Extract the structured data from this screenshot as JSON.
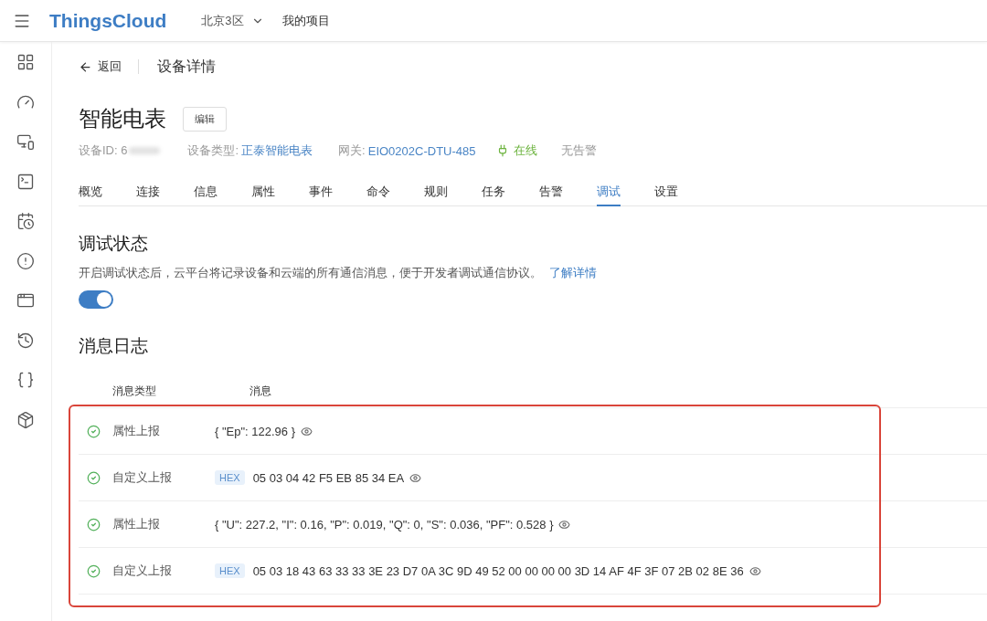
{
  "topbar": {
    "brand": "ThingsCloud",
    "region": "北京3区",
    "project": "我的项目"
  },
  "sidebar": {
    "items": [
      {
        "kind": "grid"
      },
      {
        "kind": "gauge"
      },
      {
        "kind": "devices"
      },
      {
        "kind": "terminal"
      },
      {
        "kind": "schedule"
      },
      {
        "kind": "alert"
      },
      {
        "kind": "window"
      },
      {
        "kind": "history"
      },
      {
        "kind": "braces"
      },
      {
        "kind": "package"
      }
    ]
  },
  "header": {
    "back": "返回",
    "title": "设备详情"
  },
  "device": {
    "name": "智能电表",
    "edit": "编辑",
    "id_label": "设备ID: 6",
    "type_label": "设备类型:",
    "type_value": "正泰智能电表",
    "gateway_label": "网关:",
    "gateway_value": "EIO0202C-DTU-485",
    "online": "在线",
    "alarm": "无告警"
  },
  "tabs": [
    {
      "label": "概览",
      "selected": false
    },
    {
      "label": "连接",
      "selected": false
    },
    {
      "label": "信息",
      "selected": false
    },
    {
      "label": "属性",
      "selected": false
    },
    {
      "label": "事件",
      "selected": false
    },
    {
      "label": "命令",
      "selected": false
    },
    {
      "label": "规则",
      "selected": false
    },
    {
      "label": "任务",
      "selected": false
    },
    {
      "label": "告警",
      "selected": false
    },
    {
      "label": "调试",
      "selected": true
    },
    {
      "label": "设置",
      "selected": false
    }
  ],
  "debug": {
    "title": "调试状态",
    "description": "开启调试状态后，云平台将记录设备和云端的所有通信消息，便于开发者调试通信协议。",
    "link": "了解详情",
    "on": true
  },
  "log": {
    "title": "消息日志",
    "columns": [
      "消息类型",
      "消息"
    ],
    "rows": [
      {
        "type": "属性上报",
        "badge": null,
        "message": "{ \"Ep\": 122.96 }"
      },
      {
        "type": "自定义上报",
        "badge": "HEX",
        "message": "05 03 04 42 F5 EB 85 34 EA"
      },
      {
        "type": "属性上报",
        "badge": null,
        "message": "{ \"U\": 227.2, \"I\": 0.16, \"P\": 0.019, \"Q\": 0, \"S\": 0.036, \"PF\": 0.528 }"
      },
      {
        "type": "自定义上报",
        "badge": "HEX",
        "message": "05 03 18 43 63 33 33 3E 23 D7 0A 3C 9D 49 52 00 00 00 00 3D 14 AF 4F 3F 07 2B 02 8E 36"
      }
    ]
  }
}
